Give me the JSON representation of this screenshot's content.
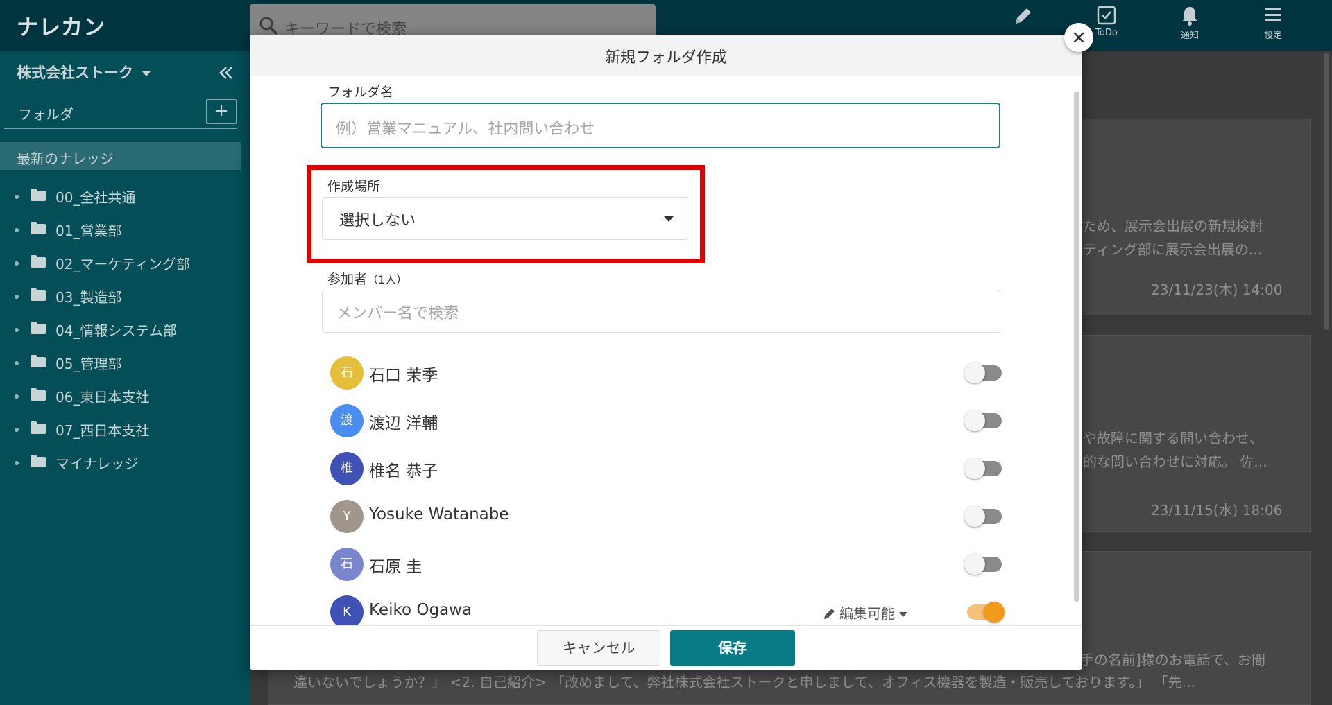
{
  "app": {
    "logo": "ナレカン"
  },
  "topbar": {
    "search_placeholder": "キーワードで検索",
    "todo_label": "ToDo",
    "notify_label": "通知",
    "settings_label": "設定"
  },
  "sidebar": {
    "company": "株式会社ストーク",
    "folder_header": "フォルダ",
    "add_label": "+",
    "recent": "最新のナレッジ",
    "folders": [
      "00_全社共通",
      "01_営業部",
      "02_マーケティング部",
      "03_製造部",
      "04_情報システム部",
      "05_管理部",
      "06_東日本支社",
      "07_西日本支社",
      "マイナレッジ"
    ]
  },
  "background": {
    "card1_line1": "ため、展示会出展の新規検討",
    "card1_line2": "ティング部に展示会出展の...",
    "card1_date": "23/11/23(木) 14:00",
    "card2_line1": "や故障に関する問い合わせ、",
    "card2_line2": "的な問い合わせに対応。 佐...",
    "card2_date": "23/11/15(水) 18:06",
    "card3_line1": "手の名前]様のお電話で、お間",
    "card3_line2": "違いないでしょうか？」 <2. 自己紹介> 「改めまして、弊社株式会社ストークと申しまして、オフィス機器を製造・販売しております。」 「先..."
  },
  "modal": {
    "title": "新規フォルダ作成",
    "name_label": "フォルダ名",
    "name_placeholder": "例）営業マニュアル、社内問い合わせ",
    "location_label": "作成場所",
    "location_value": "選択しない",
    "participants_label": "参加者",
    "participants_count": "（1人）",
    "member_search_placeholder": "メンバー名で検索",
    "members": [
      {
        "initial": "石",
        "name": "石口 茉季",
        "color": "#e5bf3a",
        "enabled": false
      },
      {
        "initial": "渡",
        "name": "渡辺 洋輔",
        "color": "#4a8ff0",
        "enabled": false
      },
      {
        "initial": "椎",
        "name": "椎名 恭子",
        "color": "#3f51b5",
        "enabled": false
      },
      {
        "initial": "Y",
        "name": "Yosuke Watanabe",
        "color": "#a1968b",
        "enabled": false
      },
      {
        "initial": "石",
        "name": "石原 圭",
        "color": "#7986cb",
        "enabled": false
      },
      {
        "initial": "K",
        "name": "Keiko Ogawa",
        "color": "#3f51b5",
        "enabled": true,
        "permission": "編集可能"
      }
    ],
    "cancel_label": "キャンセル",
    "save_label": "保存"
  },
  "colors": {
    "topbar": "#003540",
    "sidebar": "#034e57",
    "primary": "#077b86",
    "highlight": "#e00000",
    "toggle_on": "#f49a1a"
  }
}
